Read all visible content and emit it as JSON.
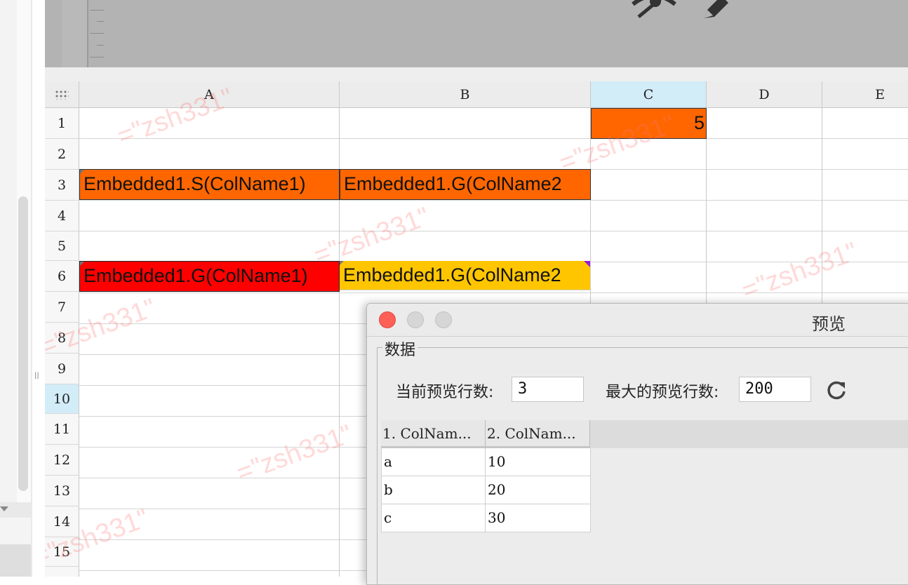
{
  "sheet": {
    "columns": [
      "A",
      "B",
      "C",
      "D",
      "E"
    ],
    "rows": [
      "1",
      "2",
      "3",
      "4",
      "5",
      "6",
      "7",
      "8",
      "9",
      "10",
      "11",
      "12",
      "13",
      "14",
      "15"
    ],
    "selected_column": "C",
    "selected_row": "10",
    "cells": {
      "c1": "5",
      "a3": "Embedded1.S(ColName1)",
      "b3": "Embedded1.G(ColName2",
      "a6": "Embedded1.G(ColName1)",
      "b6": "Embedded1.G(ColName2"
    },
    "colors": {
      "orange": "#ff6600",
      "red": "#ff0000",
      "yellow": "#ffc600",
      "selected_header": "#d2ecf8"
    },
    "watermark": "=\"zsh331\""
  },
  "toolbar": {
    "icons": [
      "eye-slash-icon",
      "pencil-icon"
    ]
  },
  "dialog": {
    "title": "预览",
    "group_label": "数据",
    "current_rows_label": "当前预览行数:",
    "current_rows_value": "3",
    "max_rows_label": "最大的预览行数:",
    "max_rows_value": "200",
    "refresh_icon": "refresh-icon",
    "table": {
      "headers": [
        "1. ColNam...",
        "2. ColNam..."
      ],
      "rows": [
        [
          "a",
          "10"
        ],
        [
          "b",
          "20"
        ],
        [
          "c",
          "30"
        ]
      ]
    }
  }
}
